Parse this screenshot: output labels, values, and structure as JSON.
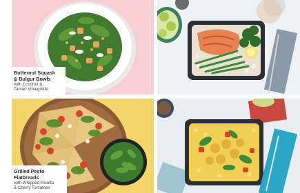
{
  "tiles": [
    {
      "title": "Butternut Squash\n& Bulgur Bowls",
      "subtitle": "with Coconut &\nTamari Vinaigrette",
      "background": "#f7cfd3"
    },
    {
      "background": "#eef1f3"
    },
    {
      "title": "Grilled Pesto\nFlatbreads",
      "subtitle": "with Whipped Ricotta\n& Cherry Tomatoes",
      "background": "#f4d56a"
    },
    {
      "background": "#eaedef"
    }
  ],
  "colors": {
    "accent_green": "#3f8a3a",
    "salmon": "#e8834f",
    "container": "#2b2e33",
    "napkin_teal": "#2aa7c4"
  }
}
